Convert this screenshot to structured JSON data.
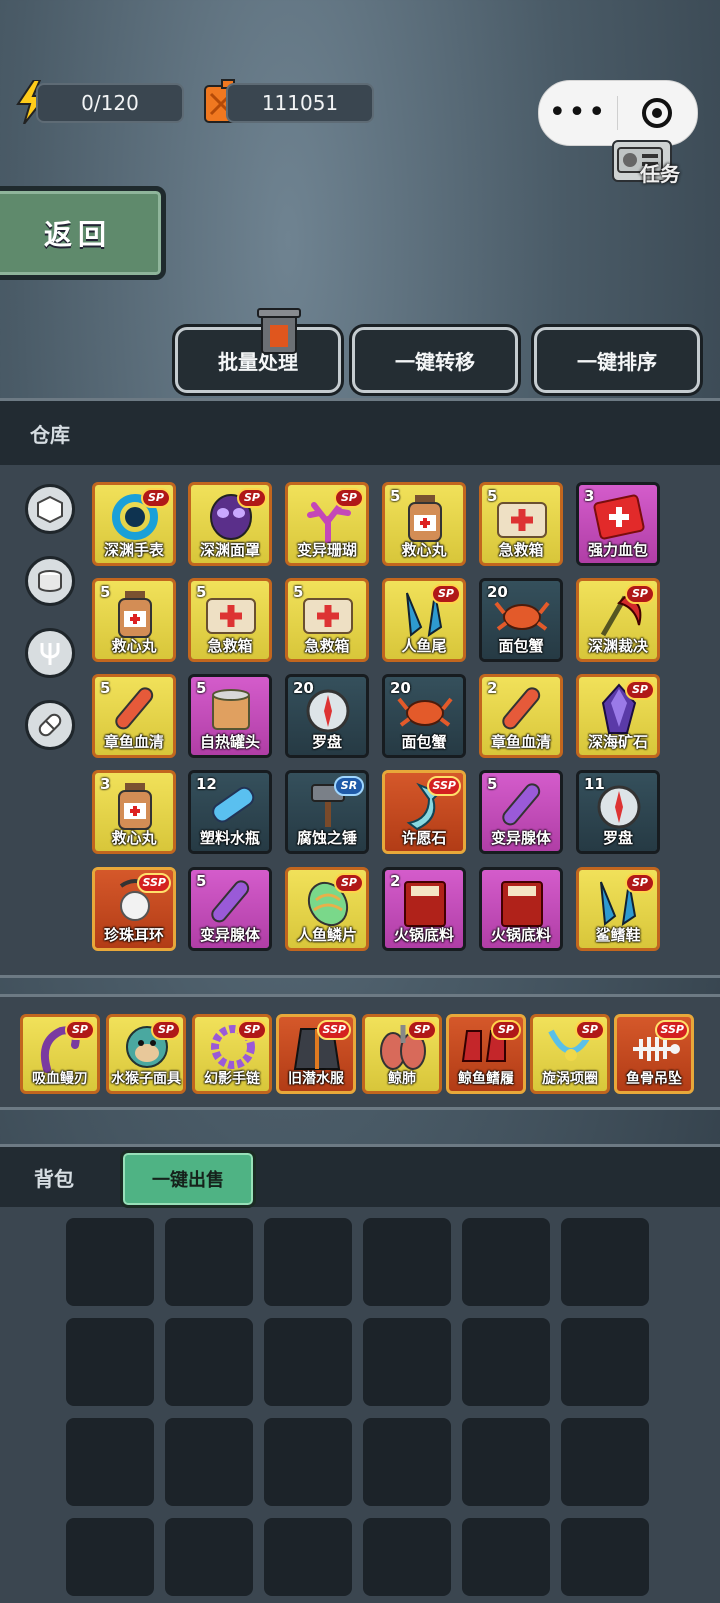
{
  "topbar": {
    "energy": "0/120",
    "fuel": "111051",
    "task_label": "任务"
  },
  "nav": {
    "back": "返回"
  },
  "actions": {
    "batch": "批量处理",
    "transfer": "一键转移",
    "sort": "一键排序"
  },
  "warehouse": {
    "title": "仓库",
    "categories": [
      "cube",
      "can",
      "fork",
      "pill"
    ],
    "items": [
      {
        "name": "深渊手表",
        "count": "",
        "badge": "SP",
        "rarity": "gold",
        "icon": "watch"
      },
      {
        "name": "深渊面罩",
        "count": "",
        "badge": "SP",
        "rarity": "gold",
        "icon": "mask"
      },
      {
        "name": "变异珊瑚",
        "count": "",
        "badge": "SP",
        "rarity": "gold",
        "icon": "coral"
      },
      {
        "name": "救心丸",
        "count": "5",
        "badge": "",
        "rarity": "gold",
        "icon": "bottle"
      },
      {
        "name": "急救箱",
        "count": "5",
        "badge": "",
        "rarity": "gold",
        "icon": "medkit"
      },
      {
        "name": "强力血包",
        "count": "3",
        "badge": "",
        "rarity": "purple",
        "icon": "bloodpack"
      },
      {
        "name": "救心丸",
        "count": "5",
        "badge": "",
        "rarity": "gold",
        "icon": "bottle"
      },
      {
        "name": "急救箱",
        "count": "5",
        "badge": "",
        "rarity": "gold",
        "icon": "medkit"
      },
      {
        "name": "急救箱",
        "count": "5",
        "badge": "",
        "rarity": "gold",
        "icon": "medkit"
      },
      {
        "name": "人鱼尾",
        "count": "",
        "badge": "SP",
        "rarity": "gold",
        "icon": "fins"
      },
      {
        "name": "面包蟹",
        "count": "20",
        "badge": "",
        "rarity": "teal",
        "icon": "crab"
      },
      {
        "name": "深渊裁决",
        "count": "",
        "badge": "SP",
        "rarity": "gold",
        "icon": "scythe"
      },
      {
        "name": "章鱼血清",
        "count": "5",
        "badge": "",
        "rarity": "gold",
        "icon": "vial-red"
      },
      {
        "name": "自热罐头",
        "count": "5",
        "badge": "",
        "rarity": "purple",
        "icon": "can"
      },
      {
        "name": "罗盘",
        "count": "20",
        "badge": "",
        "rarity": "teal",
        "icon": "compass"
      },
      {
        "name": "面包蟹",
        "count": "20",
        "badge": "",
        "rarity": "teal",
        "icon": "crab"
      },
      {
        "name": "章鱼血清",
        "count": "2",
        "badge": "",
        "rarity": "gold",
        "icon": "vial-red"
      },
      {
        "name": "深海矿石",
        "count": "",
        "badge": "SP",
        "rarity": "gold",
        "icon": "crystal"
      },
      {
        "name": "救心丸",
        "count": "3",
        "badge": "",
        "rarity": "gold",
        "icon": "bottle"
      },
      {
        "name": "塑料水瓶",
        "count": "12",
        "badge": "",
        "rarity": "teal",
        "icon": "waterbottle"
      },
      {
        "name": "腐蚀之锤",
        "count": "",
        "badge": "SR",
        "rarity": "teal",
        "icon": "hammer"
      },
      {
        "name": "许愿石",
        "count": "",
        "badge": "SSP",
        "rarity": "red",
        "icon": "tail"
      },
      {
        "name": "变异腺体",
        "count": "5",
        "badge": "",
        "rarity": "purple",
        "icon": "vial-purple"
      },
      {
        "name": "罗盘",
        "count": "11",
        "badge": "",
        "rarity": "teal",
        "icon": "compass"
      },
      {
        "name": "珍珠耳环",
        "count": "",
        "badge": "SSP",
        "rarity": "red",
        "icon": "pearl"
      },
      {
        "name": "变异腺体",
        "count": "5",
        "badge": "",
        "rarity": "purple",
        "icon": "vial-purple"
      },
      {
        "name": "人鱼鳞片",
        "count": "",
        "badge": "SP",
        "rarity": "gold",
        "icon": "scale"
      },
      {
        "name": "火锅底料",
        "count": "2",
        "badge": "",
        "rarity": "purple",
        "icon": "hotpot"
      },
      {
        "name": "火锅底料",
        "count": "",
        "badge": "",
        "rarity": "purple",
        "icon": "hotpot"
      },
      {
        "name": "鲨鳍鞋",
        "count": "",
        "badge": "SP",
        "rarity": "gold",
        "icon": "fins"
      }
    ]
  },
  "equipment": [
    {
      "name": "吸血鳗刃",
      "badge": "SP",
      "rarity": "gold",
      "icon": "eel"
    },
    {
      "name": "水猴子面具",
      "badge": "SP",
      "rarity": "gold",
      "icon": "monkey"
    },
    {
      "name": "幻影手链",
      "badge": "SP",
      "rarity": "gold",
      "icon": "bracelet"
    },
    {
      "name": "旧潜水服",
      "badge": "SSP",
      "rarity": "red",
      "icon": "suit"
    },
    {
      "name": "鲸肺",
      "badge": "SP",
      "rarity": "gold",
      "icon": "lung"
    },
    {
      "name": "鲸鱼鳍履",
      "badge": "SP",
      "rarity": "red",
      "icon": "boots"
    },
    {
      "name": "旋涡项圈",
      "badge": "SP",
      "rarity": "gold",
      "icon": "necklace"
    },
    {
      "name": "鱼骨吊坠",
      "badge": "SSP",
      "rarity": "red",
      "icon": "fishbone"
    }
  ],
  "bag": {
    "title": "背包",
    "sell_all": "一键出售",
    "empty_slots": 24
  },
  "colors": {
    "gold": "#e8d64a",
    "purple": "#c448b8",
    "teal": "#2c3f48",
    "red": "#c94a22"
  }
}
